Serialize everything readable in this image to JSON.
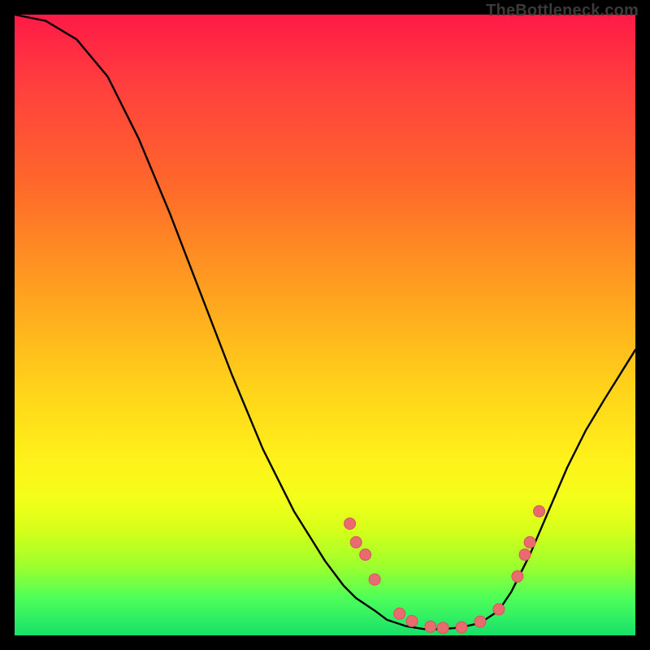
{
  "watermark": "TheBottleneck.com",
  "colors": {
    "frame": "#000000",
    "curve": "#000000",
    "marker_fill": "#e96a6f",
    "marker_stroke": "#d4575c"
  },
  "chart_data": {
    "type": "line",
    "title": "",
    "xlabel": "",
    "ylabel": "",
    "xlim": [
      0,
      100
    ],
    "ylim": [
      0,
      100
    ],
    "grid": false,
    "curve_xy": [
      [
        0,
        100
      ],
      [
        5,
        99
      ],
      [
        10,
        96
      ],
      [
        15,
        90
      ],
      [
        20,
        80
      ],
      [
        25,
        68
      ],
      [
        30,
        55
      ],
      [
        35,
        42
      ],
      [
        40,
        30
      ],
      [
        45,
        20
      ],
      [
        50,
        12
      ],
      [
        53,
        8
      ],
      [
        55,
        6
      ],
      [
        58,
        4
      ],
      [
        60,
        2.5
      ],
      [
        63,
        1.5
      ],
      [
        66,
        1
      ],
      [
        69,
        1
      ],
      [
        72,
        1.3
      ],
      [
        75,
        2
      ],
      [
        78,
        4
      ],
      [
        80,
        7
      ],
      [
        83,
        13
      ],
      [
        86,
        20
      ],
      [
        89,
        27
      ],
      [
        92,
        33
      ],
      [
        95,
        38
      ],
      [
        100,
        46
      ]
    ],
    "markers_xy": [
      [
        54,
        18
      ],
      [
        55,
        15
      ],
      [
        56.5,
        13
      ],
      [
        58,
        9
      ],
      [
        62,
        3.5
      ],
      [
        64,
        2.3
      ],
      [
        67,
        1.4
      ],
      [
        69,
        1.2
      ],
      [
        72,
        1.3
      ],
      [
        75,
        2.2
      ],
      [
        78,
        4.2
      ],
      [
        81,
        9.5
      ],
      [
        82.2,
        13
      ],
      [
        83,
        15
      ],
      [
        84.5,
        20
      ]
    ]
  }
}
